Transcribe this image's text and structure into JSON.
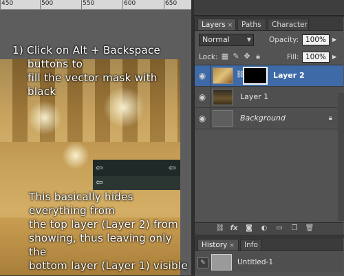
{
  "ruler": {
    "labels": [
      "450",
      "500",
      "550",
      "600",
      "650"
    ]
  },
  "annotation": {
    "step_lines": [
      "1) Click on Alt + Backspace",
      "buttons to",
      "fill the vector mask with",
      "black"
    ],
    "explanation_lines": [
      "This basically hides everything from",
      "the top layer (Layer 2) from",
      "showing, thus leaving only the",
      "bottom layer (Layer 1) visible"
    ]
  },
  "layers_panel": {
    "tabs": [
      {
        "label": "Layers",
        "close": "×"
      },
      {
        "label": "Paths"
      },
      {
        "label": "Character"
      }
    ],
    "blend_mode": "Normal",
    "opacity_label": "Opacity:",
    "opacity_value": "100%",
    "lock_label": "Lock:",
    "fill_label": "Fill:",
    "fill_value": "100%",
    "layers": [
      {
        "name": "Layer 2"
      },
      {
        "name": "Layer 1"
      },
      {
        "name": "Background"
      }
    ],
    "bottom_icons": [
      "link-icon",
      "fx-icon",
      "mask-icon",
      "adjustment-icon",
      "folder-icon",
      "new-layer-icon",
      "trash-icon"
    ]
  },
  "history_panel": {
    "tabs": [
      {
        "label": "History",
        "close": "×"
      },
      {
        "label": "Info"
      }
    ],
    "items": [
      {
        "name": "Untitled-1"
      }
    ]
  },
  "colors": {
    "selection": "#3e6aa8",
    "panel_bg": "#535353",
    "text_overlay": "#ffffff"
  }
}
